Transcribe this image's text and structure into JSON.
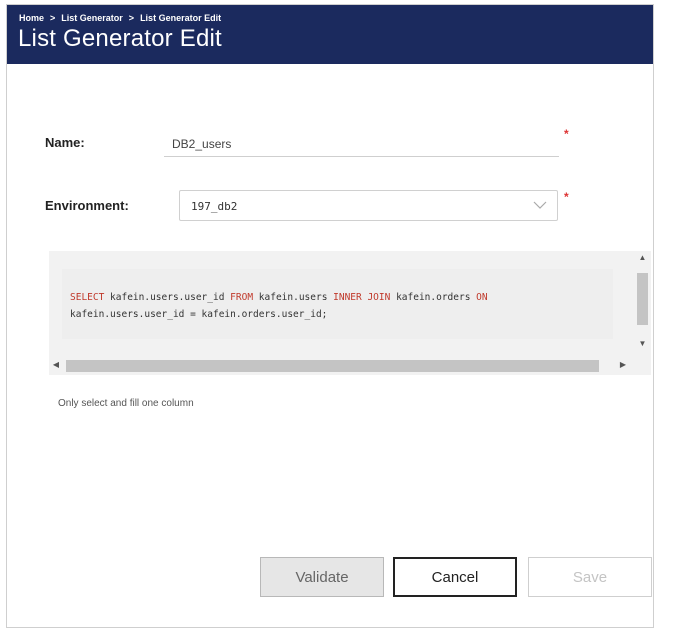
{
  "header": {
    "breadcrumb": [
      "Home",
      "List Generator",
      "List Generator Edit"
    ],
    "separator": ">",
    "title": "List Generator Edit",
    "background_color": "#1b2a5e"
  },
  "form": {
    "name_label": "Name:",
    "name_value": "DB2_users",
    "environment_label": "Environment:",
    "environment_value": "197_db2",
    "required_marker": "*"
  },
  "editor": {
    "code_segments": [
      {
        "text": "SELECT",
        "keyword": true
      },
      {
        "text": " kafein.users.user_id ",
        "keyword": false
      },
      {
        "text": "FROM",
        "keyword": true
      },
      {
        "text": " kafein.users ",
        "keyword": false
      },
      {
        "text": "INNER JOIN",
        "keyword": true
      },
      {
        "text": " kafein.orders ",
        "keyword": false
      },
      {
        "text": "ON",
        "keyword": true
      },
      {
        "text": "\nkafein.users.user_id = kafein.orders.user_id;",
        "keyword": false
      }
    ],
    "keyword_color": "#c0392b"
  },
  "hint": "Only select and fill one column",
  "buttons": {
    "validate": "Validate",
    "cancel": "Cancel",
    "save": "Save"
  }
}
